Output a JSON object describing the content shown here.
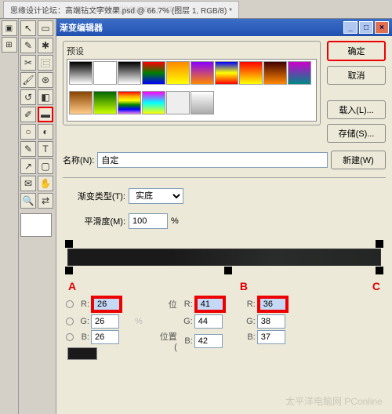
{
  "tab": {
    "title": "思缘设计论坛：高端钻文字效果.psd @ 66.7% (图层 1, RGB/8) *"
  },
  "dialog": {
    "title": "渐变编辑器",
    "buttons": {
      "ok": "确定",
      "cancel": "取消",
      "load": "载入(L)...",
      "save": "存储(S)...",
      "new": "新建(W)"
    },
    "preset_label": "预设",
    "name_label": "名称(N):",
    "name_value": "自定",
    "type_label": "渐变类型(T):",
    "type_value": "实底",
    "smooth_label": "平滑度(M):",
    "smooth_value": "100",
    "smooth_unit": "%",
    "pos_label": "位",
    "location_label": "位置(",
    "pct": "%",
    "markers": {
      "a": "A",
      "b": "B",
      "c": "C"
    }
  },
  "rgb": {
    "a": {
      "r": "26",
      "g": "26",
      "b": "26"
    },
    "b": {
      "r": "41",
      "g": "44",
      "b": "42"
    },
    "c": {
      "r": "36",
      "g": "38",
      "b": "37"
    }
  },
  "watermark": "www.xieeyuan.com",
  "watermark2": "太平洋电脑网 PConline"
}
